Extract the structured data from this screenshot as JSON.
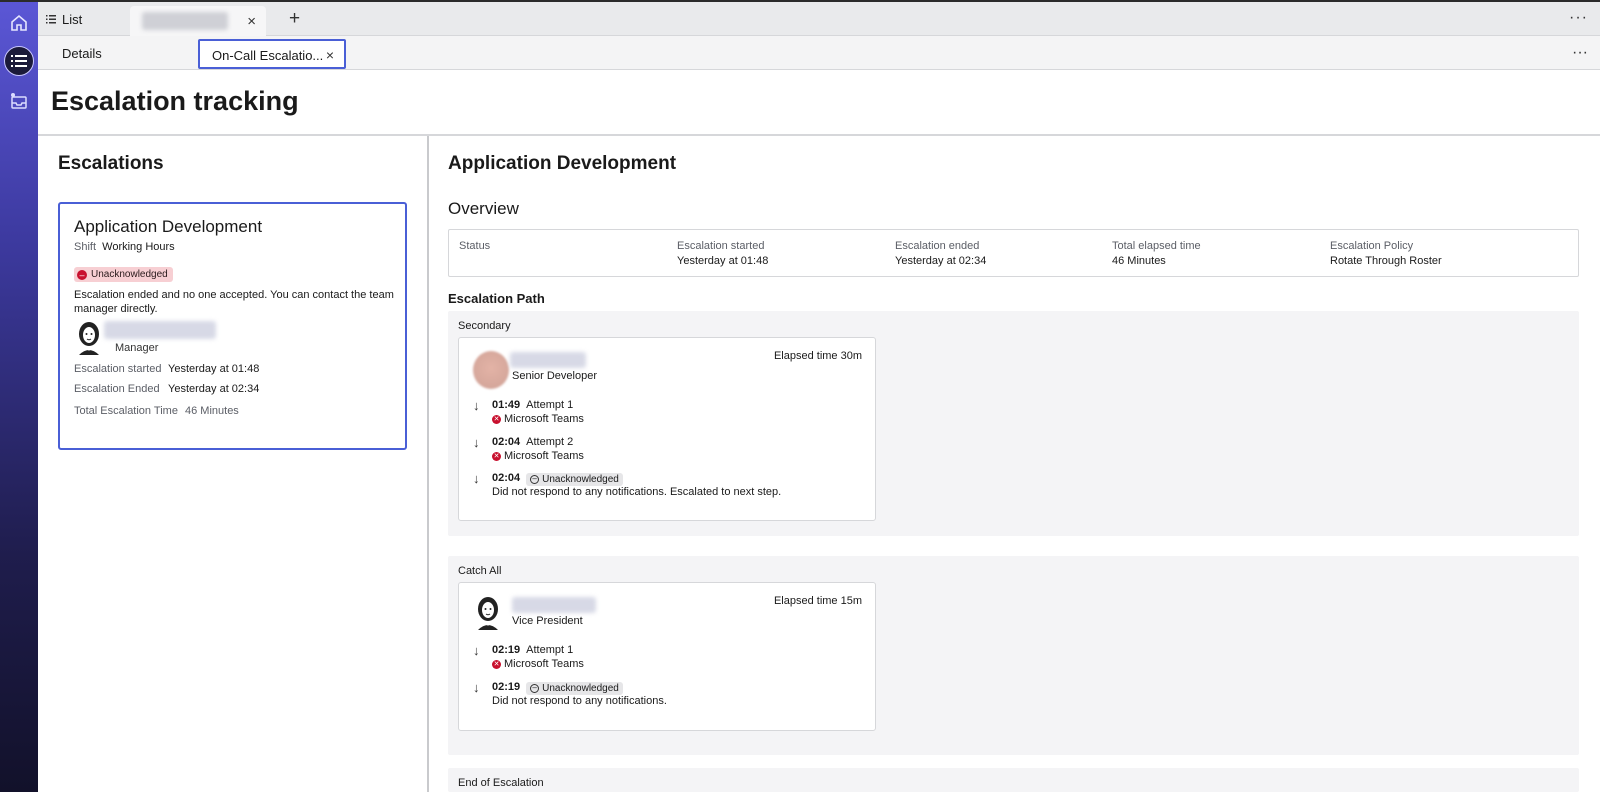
{
  "top_tabs": {
    "list_label": "List",
    "close_symbol": "×",
    "add_symbol": "+",
    "more_symbol": "···"
  },
  "sub_tabs": {
    "details_label": "Details",
    "active_label": "On-Call Escalatio...",
    "close_symbol": "×",
    "more_symbol": "···"
  },
  "page": {
    "title": "Escalation tracking"
  },
  "escalations": {
    "heading": "Escalations",
    "card": {
      "title": "Application Development",
      "shift_label": "Shift",
      "shift_value": "Working Hours",
      "status_badge": "Unacknowledged",
      "message": "Escalation ended and no one accepted. You can contact the team manager directly.",
      "manager_role": "Manager",
      "started_label": "Escalation started",
      "started_value": "Yesterday at 01:48",
      "ended_label": "Escalation Ended",
      "ended_value": "Yesterday at 02:34",
      "total_label": "Total Escalation Time",
      "total_value": "46 Minutes"
    }
  },
  "detail": {
    "title": "Application Development",
    "overview_title": "Overview",
    "overview": [
      {
        "label": "Status",
        "value": ""
      },
      {
        "label": "Escalation started",
        "value": "Yesterday at 01:48"
      },
      {
        "label": "Escalation ended",
        "value": "Yesterday at 02:34"
      },
      {
        "label": "Total elapsed time",
        "value": "46 Minutes"
      },
      {
        "label": "Escalation Policy",
        "value": "Rotate Through Roster"
      }
    ],
    "path_title": "Escalation Path",
    "steps": [
      {
        "label": "Secondary",
        "role": "Senior Developer",
        "elapsed": "Elapsed time 30m",
        "attempts": [
          {
            "time": "01:49",
            "title": "Attempt 1",
            "channel": "Microsoft Teams"
          },
          {
            "time": "02:04",
            "title": "Attempt 2",
            "channel": "Microsoft Teams"
          },
          {
            "time": "02:04",
            "badge": "Unacknowledged",
            "note": "Did not respond to any notifications. Escalated to next step."
          }
        ]
      },
      {
        "label": "Catch All",
        "role": "Vice President",
        "elapsed": "Elapsed time 15m",
        "attempts": [
          {
            "time": "02:19",
            "title": "Attempt 1",
            "channel": "Microsoft Teams"
          },
          {
            "time": "02:19",
            "badge": "Unacknowledged",
            "note": "Did not respond to any notifications."
          }
        ]
      },
      {
        "label": "End of Escalation"
      }
    ]
  },
  "icons": {
    "home": "home-icon",
    "list": "list-icon",
    "inbox": "inbox-icon",
    "status_error": "minus-circle-icon",
    "channel_failed": "x-circle-icon",
    "attempt_arrow": "arrow-down-icon"
  },
  "colors": {
    "accent": "#4a5fd6",
    "error": "#c8102e",
    "badge_red_bg": "#f7cfd3"
  }
}
